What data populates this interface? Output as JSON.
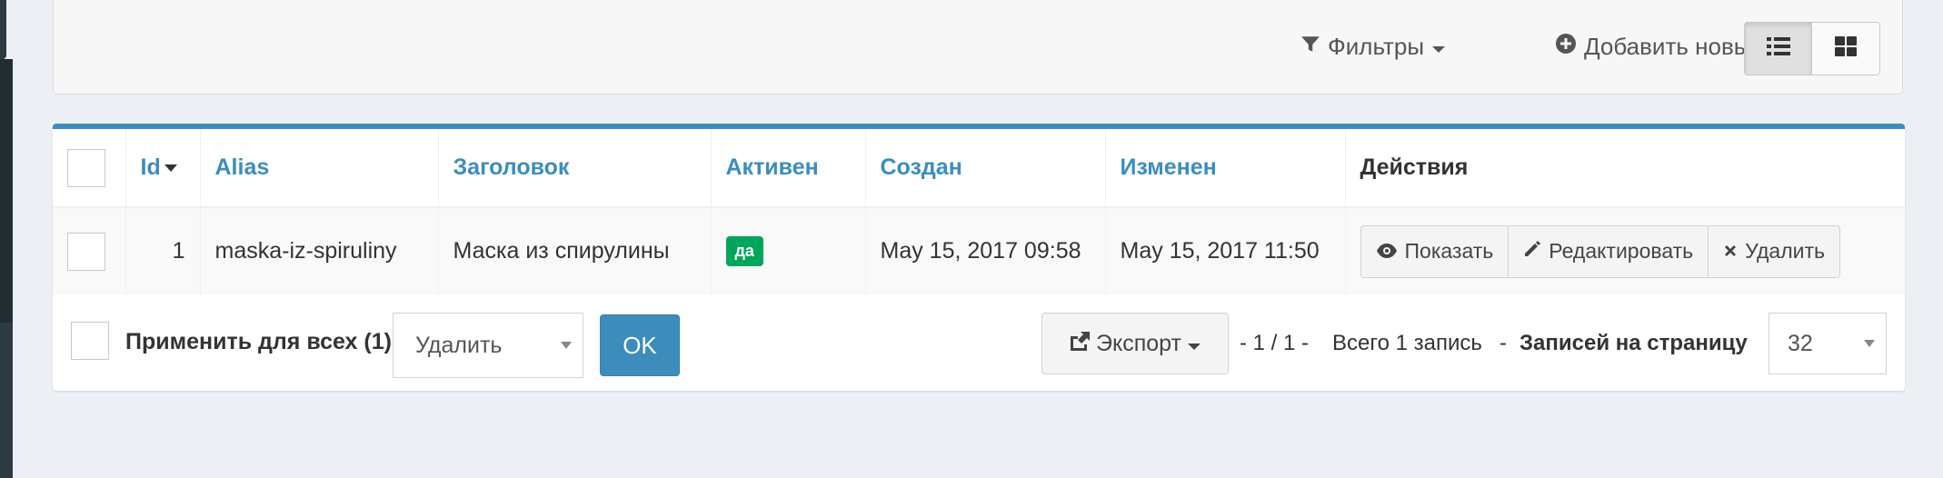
{
  "toolbar": {
    "filters_label": "Фильтры",
    "add_label": "Добавить новый",
    "view_modes": [
      "list",
      "grid"
    ],
    "active_view": "list"
  },
  "table": {
    "columns": [
      "Id",
      "Alias",
      "Заголовок",
      "Активен",
      "Создан",
      "Изменен",
      "Действия"
    ],
    "rows": [
      {
        "id": "1",
        "alias": "maska-iz-spiruliny",
        "title": "Маска из спирулины",
        "active": "да",
        "created": "May 15, 2017 09:58",
        "updated": "May 15, 2017 11:50",
        "actions": [
          "Показать",
          "Редактировать",
          "Удалить"
        ]
      }
    ]
  },
  "footer": {
    "apply_all_label": "Применить для всех (1)",
    "bulk_action_selected": "Удалить",
    "ok_label": "OK",
    "export_label": "Экспорт",
    "page_info": "- 1 / 1 -",
    "total_info": "Всего 1 запись",
    "per_page_sep": "-",
    "per_page_label": "Записей на страницу",
    "per_page_value": "32"
  },
  "colors": {
    "accent": "#3c8dbc",
    "success": "#00a65a",
    "background": "#ecf0f5"
  }
}
